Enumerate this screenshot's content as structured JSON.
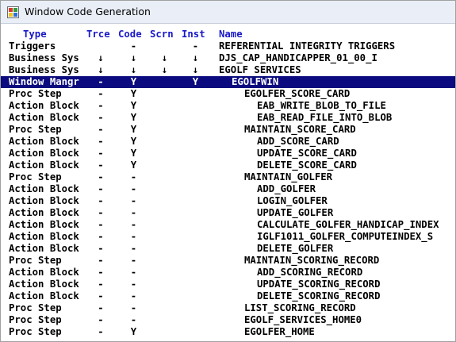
{
  "window": {
    "title": "Window Code Generation",
    "icon": "app-window-icon"
  },
  "header": {
    "type": "Type",
    "trce": "Trce",
    "code": "Code",
    "scrn": "Scrn",
    "inst": "Inst",
    "name": "Name"
  },
  "colors": {
    "header_text": "#1818c8",
    "selection_bg": "#0b0b7f",
    "selection_text": "#ffffff"
  },
  "rows": [
    {
      "type": "Triggers",
      "trce": "",
      "code": "-",
      "scrn": "",
      "inst": "-",
      "name": "REFERENTIAL INTEGRITY TRIGGERS",
      "indent": 0
    },
    {
      "type": "Business Sys",
      "trce": "↓",
      "code": "↓",
      "scrn": "↓",
      "inst": "↓",
      "name": "DJS_CAP_HANDICAPPER_01_00_I",
      "indent": 0
    },
    {
      "type": "Business Sys",
      "trce": "↓",
      "code": "↓",
      "scrn": "↓",
      "inst": "↓",
      "name": "EGOLF SERVICES",
      "indent": 0
    },
    {
      "type": "Window Mangr",
      "trce": "-",
      "code": "Y",
      "scrn": "",
      "inst": "Y",
      "name": "EGOLFWIN",
      "indent": 1,
      "selected": true
    },
    {
      "type": "Proc Step",
      "trce": "-",
      "code": "Y",
      "scrn": "",
      "inst": "",
      "name": "EGOLFER_SCORE_CARD",
      "indent": 2
    },
    {
      "type": "Action Block",
      "trce": "-",
      "code": "Y",
      "scrn": "",
      "inst": "",
      "name": "EAB_WRITE_BLOB_TO_FILE",
      "indent": 3
    },
    {
      "type": "Action Block",
      "trce": "-",
      "code": "Y",
      "scrn": "",
      "inst": "",
      "name": "EAB_READ_FILE_INTO_BLOB",
      "indent": 3
    },
    {
      "type": "Proc Step",
      "trce": "-",
      "code": "Y",
      "scrn": "",
      "inst": "",
      "name": "MAINTAIN_SCORE_CARD",
      "indent": 2
    },
    {
      "type": "Action Block",
      "trce": "-",
      "code": "Y",
      "scrn": "",
      "inst": "",
      "name": "ADD_SCORE_CARD",
      "indent": 3
    },
    {
      "type": "Action Block",
      "trce": "-",
      "code": "Y",
      "scrn": "",
      "inst": "",
      "name": "UPDATE_SCORE_CARD",
      "indent": 3
    },
    {
      "type": "Action Block",
      "trce": "-",
      "code": "Y",
      "scrn": "",
      "inst": "",
      "name": "DELETE_SCORE_CARD",
      "indent": 3
    },
    {
      "type": "Proc Step",
      "trce": "-",
      "code": "-",
      "scrn": "",
      "inst": "",
      "name": "MAINTAIN_GOLFER",
      "indent": 2
    },
    {
      "type": "Action Block",
      "trce": "-",
      "code": "-",
      "scrn": "",
      "inst": "",
      "name": "ADD_GOLFER",
      "indent": 3
    },
    {
      "type": "Action Block",
      "trce": "-",
      "code": "-",
      "scrn": "",
      "inst": "",
      "name": "LOGIN_GOLFER",
      "indent": 3
    },
    {
      "type": "Action Block",
      "trce": "-",
      "code": "-",
      "scrn": "",
      "inst": "",
      "name": "UPDATE_GOLFER",
      "indent": 3
    },
    {
      "type": "Action Block",
      "trce": "-",
      "code": "-",
      "scrn": "",
      "inst": "",
      "name": "CALCULATE_GOLFER_HANDICAP_INDEX",
      "indent": 3
    },
    {
      "type": "Action Block",
      "trce": "-",
      "code": "-",
      "scrn": "",
      "inst": "",
      "name": "IGLF1011_GOLFER_COMPUTEINDEX_S",
      "indent": 3
    },
    {
      "type": "Action Block",
      "trce": "-",
      "code": "-",
      "scrn": "",
      "inst": "",
      "name": "DELETE_GOLFER",
      "indent": 3
    },
    {
      "type": "Proc Step",
      "trce": "-",
      "code": "-",
      "scrn": "",
      "inst": "",
      "name": "MAINTAIN_SCORING_RECORD",
      "indent": 2
    },
    {
      "type": "Action Block",
      "trce": "-",
      "code": "-",
      "scrn": "",
      "inst": "",
      "name": "ADD_SCORING_RECORD",
      "indent": 3
    },
    {
      "type": "Action Block",
      "trce": "-",
      "code": "-",
      "scrn": "",
      "inst": "",
      "name": "UPDATE_SCORING_RECORD",
      "indent": 3
    },
    {
      "type": "Action Block",
      "trce": "-",
      "code": "-",
      "scrn": "",
      "inst": "",
      "name": "DELETE_SCORING_RECORD",
      "indent": 3
    },
    {
      "type": "Proc Step",
      "trce": "-",
      "code": "-",
      "scrn": "",
      "inst": "",
      "name": "LIST_SCORING_RECORD",
      "indent": 2
    },
    {
      "type": "Proc Step",
      "trce": "-",
      "code": "-",
      "scrn": "",
      "inst": "",
      "name": "EGOLF_SERVICES_HOME0",
      "indent": 2
    },
    {
      "type": "Proc Step",
      "trce": "-",
      "code": "Y",
      "scrn": "",
      "inst": "",
      "name": "EGOLFER_HOME",
      "indent": 2
    }
  ]
}
